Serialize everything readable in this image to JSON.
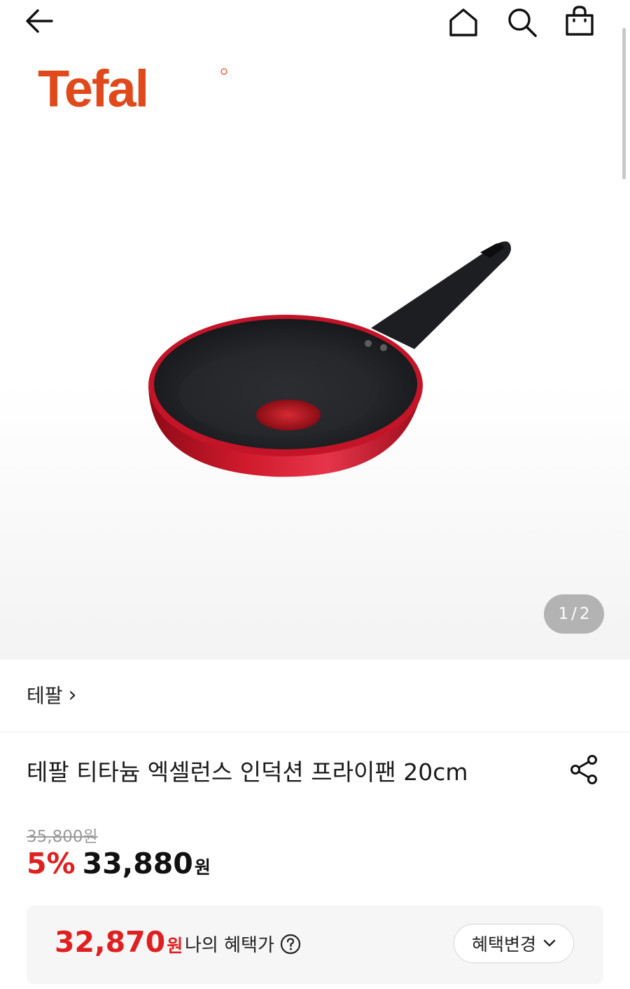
{
  "header": {
    "back_icon": "arrow-left-icon",
    "home_icon": "home-icon",
    "search_icon": "search-icon",
    "cart_icon": "shopping-bag-icon"
  },
  "hero": {
    "logo_text": "Tefal",
    "logo_color": "#e0491a",
    "image_index": "1",
    "image_separator": "/",
    "image_total": "2"
  },
  "brand": {
    "name": "테팔",
    "chevron": "›"
  },
  "product": {
    "title": "테팔 티타늄 엑셀런스 인덕션 프라이팬 20cm",
    "share_icon": "share-icon"
  },
  "price": {
    "original": "35,800원",
    "discount_rate": "5%",
    "sale_price": "33,880",
    "currency": "원",
    "accent_color": "#e02020"
  },
  "benefit": {
    "amount": "32,870",
    "currency": "원",
    "label": "나의 혜택가",
    "help_icon": "question-circle-icon",
    "change_button": "혜택변경",
    "change_icon": "chevron-down-icon"
  }
}
